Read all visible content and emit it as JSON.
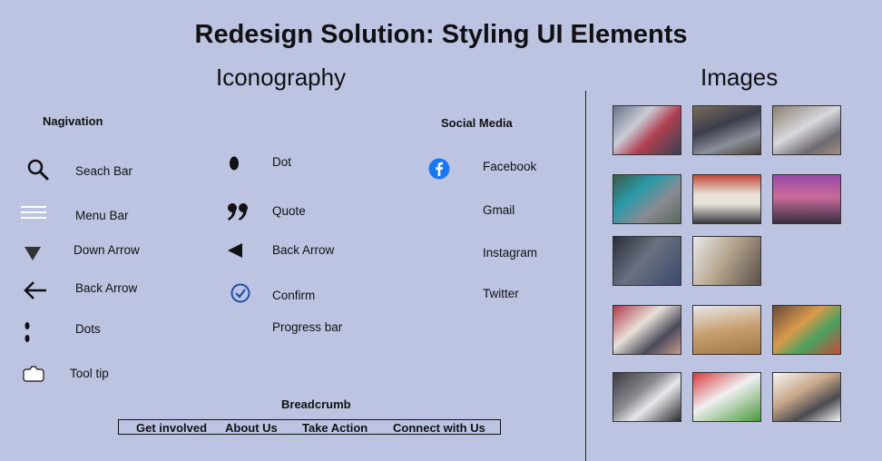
{
  "title": "Redesign Solution: Styling UI Elements",
  "sections": {
    "iconography": "Iconography",
    "images": "Images"
  },
  "navigation": {
    "heading": "Nagivation",
    "items": [
      {
        "label": "Seach Bar",
        "icon": "search-icon"
      },
      {
        "label": "Menu Bar",
        "icon": "menu-icon"
      },
      {
        "label": "Down Arrow",
        "icon": "down-arrow-icon"
      },
      {
        "label": "Back Arrow",
        "icon": "back-arrow-icon"
      },
      {
        "label": "Dots",
        "icon": "dots-icon"
      },
      {
        "label": "Tool tip",
        "icon": "tooltip-icon"
      }
    ]
  },
  "middle_icons": {
    "items": [
      {
        "label": "Dot",
        "icon": "dot-icon"
      },
      {
        "label": "Quote",
        "icon": "quote-icon"
      },
      {
        "label": "Back Arrow",
        "icon": "triangle-left-icon"
      },
      {
        "label": "Confirm",
        "icon": "check-circle-icon"
      },
      {
        "label": "Progress bar",
        "icon": ""
      }
    ]
  },
  "social": {
    "heading": "Social Media",
    "items": [
      {
        "label": "Facebook",
        "icon": "facebook-icon"
      },
      {
        "label": "Gmail"
      },
      {
        "label": "Instagram"
      },
      {
        "label": "Twitter"
      }
    ]
  },
  "breadcrumb": {
    "heading": "Breadcrumb",
    "items": [
      "Get involved",
      "About Us",
      "Take Action",
      "Connect with Us"
    ]
  },
  "colors": {
    "background": "#bcc4e2",
    "facebook": "#1877f2",
    "confirm": "#1f4fa8"
  }
}
